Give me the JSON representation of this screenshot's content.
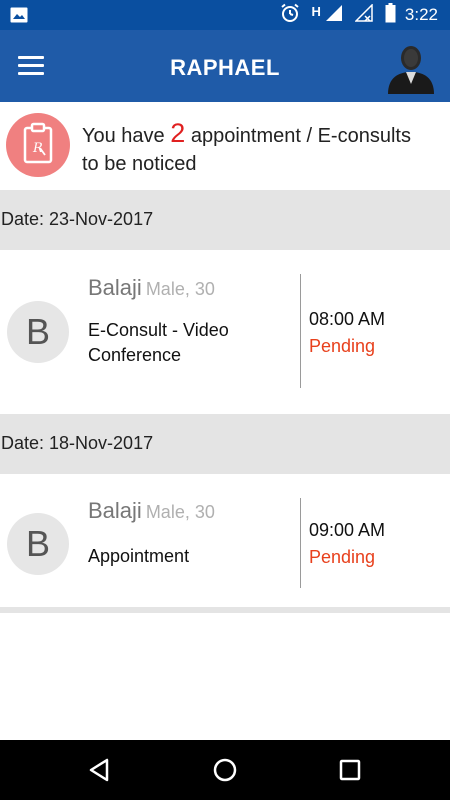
{
  "status_bar": {
    "time": "3:22",
    "network_label": "H",
    "icons": [
      "image-icon",
      "alarm-icon",
      "signal-icon",
      "signal-empty-icon",
      "battery-icon"
    ]
  },
  "app_bar": {
    "title": "RAPHAEL",
    "menu_icon": "hamburger-menu-icon",
    "profile_icon": "user-avatar-icon",
    "background": "#1f5ba8"
  },
  "notice": {
    "prefix": "You have ",
    "count": "2",
    "suffix": " appointment / E-consults to be noticed",
    "icon": "prescription-clipboard-icon",
    "icon_bg": "#f08080",
    "count_color": "#e02020"
  },
  "appointments": [
    {
      "date_label": "Date: 23-Nov-2017",
      "initial": "B",
      "name": "Balaji",
      "meta": "Male, 30",
      "type": "E-Consult - Video Conference",
      "time": "08:00 AM",
      "status": "Pending"
    },
    {
      "date_label": "Date: 18-Nov-2017",
      "initial": "B",
      "name": "Balaji",
      "meta": "Male, 30",
      "type": "Appointment",
      "time": "09:00 AM",
      "status": "Pending"
    }
  ],
  "colors": {
    "status_pending": "#e8401c",
    "section_bg": "#e4e4e4"
  },
  "nav_bar": {
    "icons": [
      "back-triangle-icon",
      "home-circle-icon",
      "recents-square-icon"
    ]
  }
}
